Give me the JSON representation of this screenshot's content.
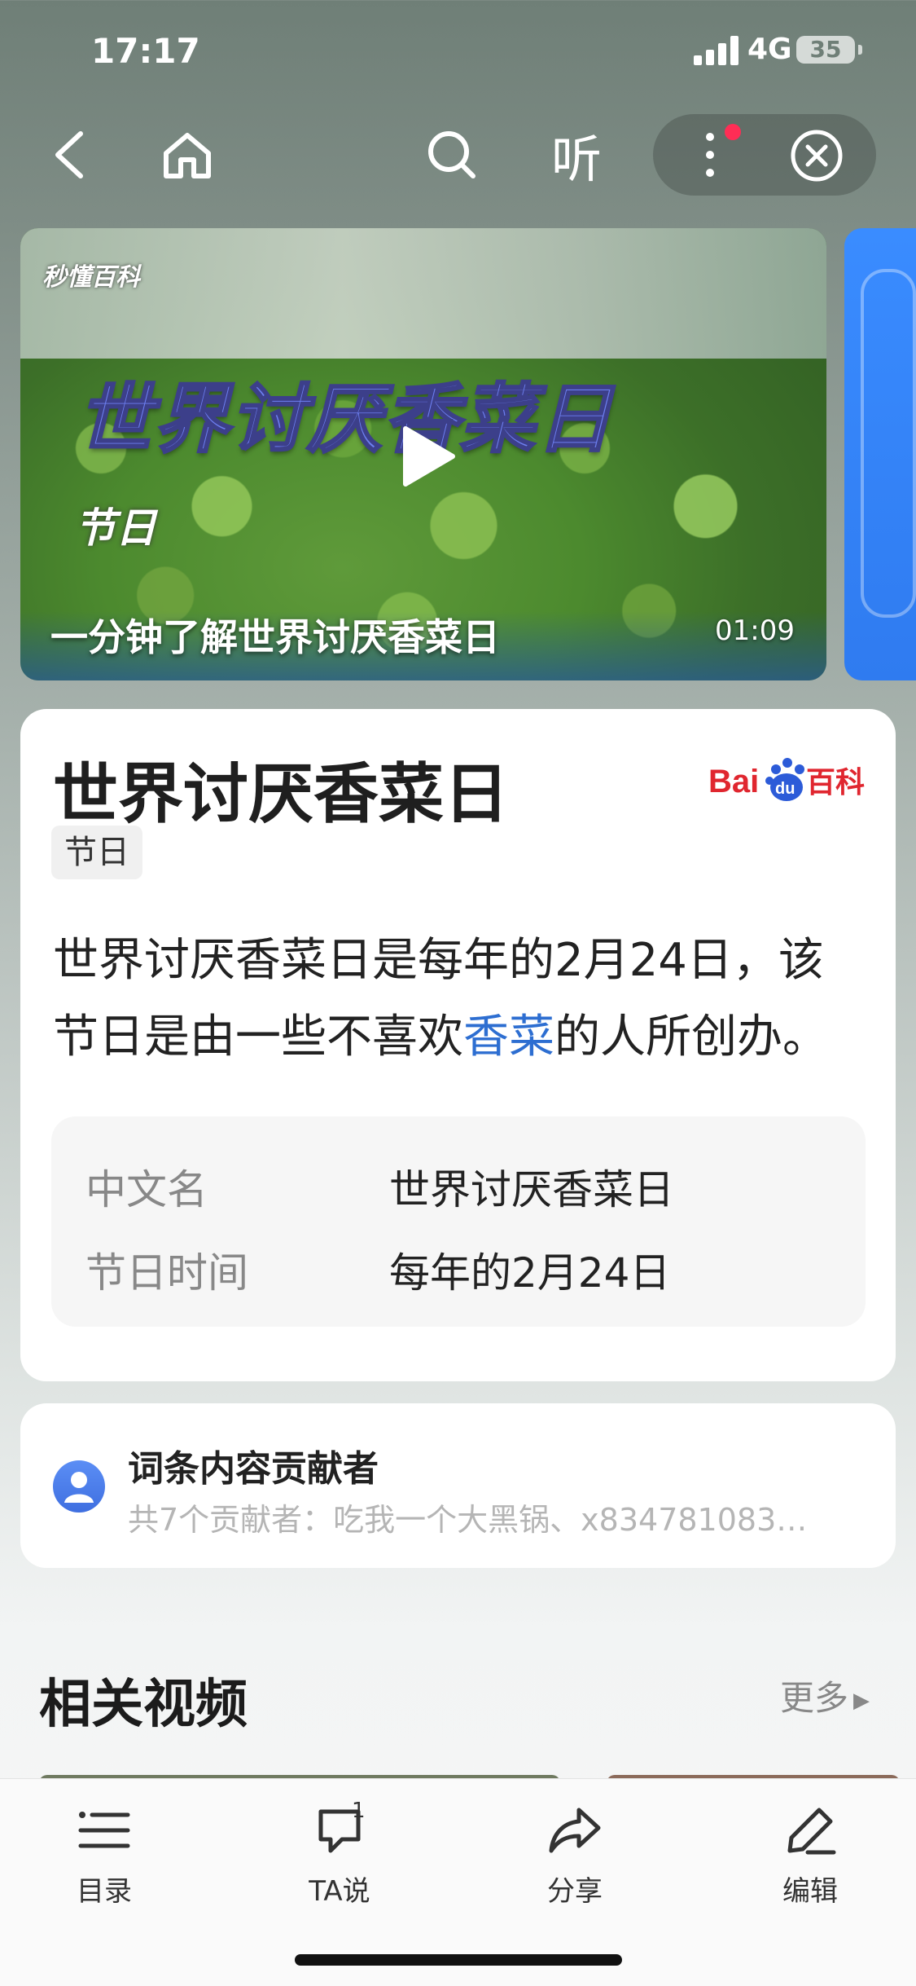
{
  "status_bar": {
    "time": "17:17",
    "network": "4G",
    "battery": "35"
  },
  "top_nav": {
    "back_icon": "chevron-left-icon",
    "home_icon": "home-icon",
    "search_icon": "search-icon",
    "listen_label": "听",
    "more_icon": "more-vertical-icon",
    "close_icon": "close-circle-icon"
  },
  "video": {
    "watermark": "秒懂百科",
    "overlay_title": "世界讨厌香菜日",
    "overlay_category": "节日",
    "caption": "一分钟了解世界讨厌香菜日",
    "duration": "01:09"
  },
  "entry": {
    "title": "世界讨厌香菜日",
    "brand": "Baidu百科",
    "tag": "节日",
    "description_before": "世界讨厌香菜日是每年的2月24日，该节日是由一些不喜欢",
    "description_link": "香菜",
    "description_after": "的人所创办。",
    "infobox": [
      {
        "key": "中文名",
        "value": "世界讨厌香菜日"
      },
      {
        "key": "节日时间",
        "value": "每年的2月24日"
      }
    ]
  },
  "contributors": {
    "title": "词条内容贡献者",
    "subtitle": "共7个贡献者：吃我一个大黑锅、x834781083…"
  },
  "related": {
    "title": "相关视频",
    "more_label": "更多"
  },
  "tabbar": {
    "items": [
      {
        "label": "目录",
        "icon": "list-icon"
      },
      {
        "label": "TA说",
        "icon": "comment-icon",
        "badge": "1"
      },
      {
        "label": "分享",
        "icon": "share-icon"
      },
      {
        "label": "编辑",
        "icon": "edit-icon"
      }
    ]
  },
  "colors": {
    "link": "#2d6ed1",
    "brand_red": "#e0262f",
    "notification_dot": "#ff2d55"
  }
}
